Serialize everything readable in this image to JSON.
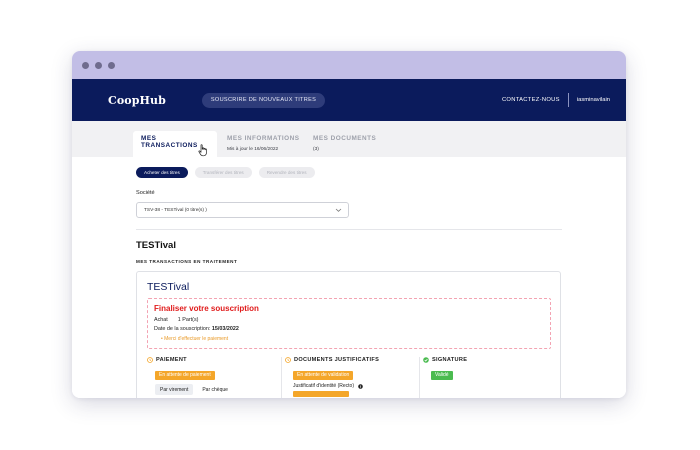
{
  "app": {
    "logo": "CoopHub",
    "subscribe_button": "SOUSCRIRE DE NOUVEAUX TITRES",
    "contact": "CONTACTEZ-NOUS",
    "user": "iasminavilain"
  },
  "tabs": [
    {
      "label": "MES TRANSACTIONS",
      "sub": ""
    },
    {
      "label": "MES INFORMATIONS",
      "sub": "Mis à jour le 16/06/2022"
    },
    {
      "label": "MES DOCUMENTS",
      "sub": "(3)"
    }
  ],
  "pills": [
    "Acheter des titres",
    "Transférer des titres",
    "Revendre des titres"
  ],
  "societe": {
    "label": "Société",
    "selected": "TSV-38 - TESTival (0 titre(s) )"
  },
  "company_title": "TESTival",
  "section_heading": "MES TRANSACTIONS EN TRAITEMENT",
  "transaction": {
    "card_title": "TESTival",
    "alert_title": "Finaliser votre souscription",
    "type": "Achat",
    "parts": "1 Part(s)",
    "date_label": "Date de la souscription:",
    "date_value": "15/03/2022",
    "notice": "•  Merci d'effectuer le paiement"
  },
  "steps": {
    "paiement": {
      "title": "PAIEMENT",
      "status": "En attente de paiement",
      "btn_virement": "Par virement",
      "btn_cheque": "Par chèque"
    },
    "documents": {
      "title": "DOCUMENTS JUSTIFICATIFS",
      "status": "En attente de validation",
      "justif": "Justificatif d'identité (Recto)"
    },
    "signature": {
      "title": "SIGNATURE",
      "status": "Validé"
    }
  },
  "colors": {
    "navy": "#0b1b5c",
    "titlebar": "#c2bee6",
    "orange": "#f4a62a",
    "green": "#4bbb50",
    "red": "#e01b1b"
  }
}
